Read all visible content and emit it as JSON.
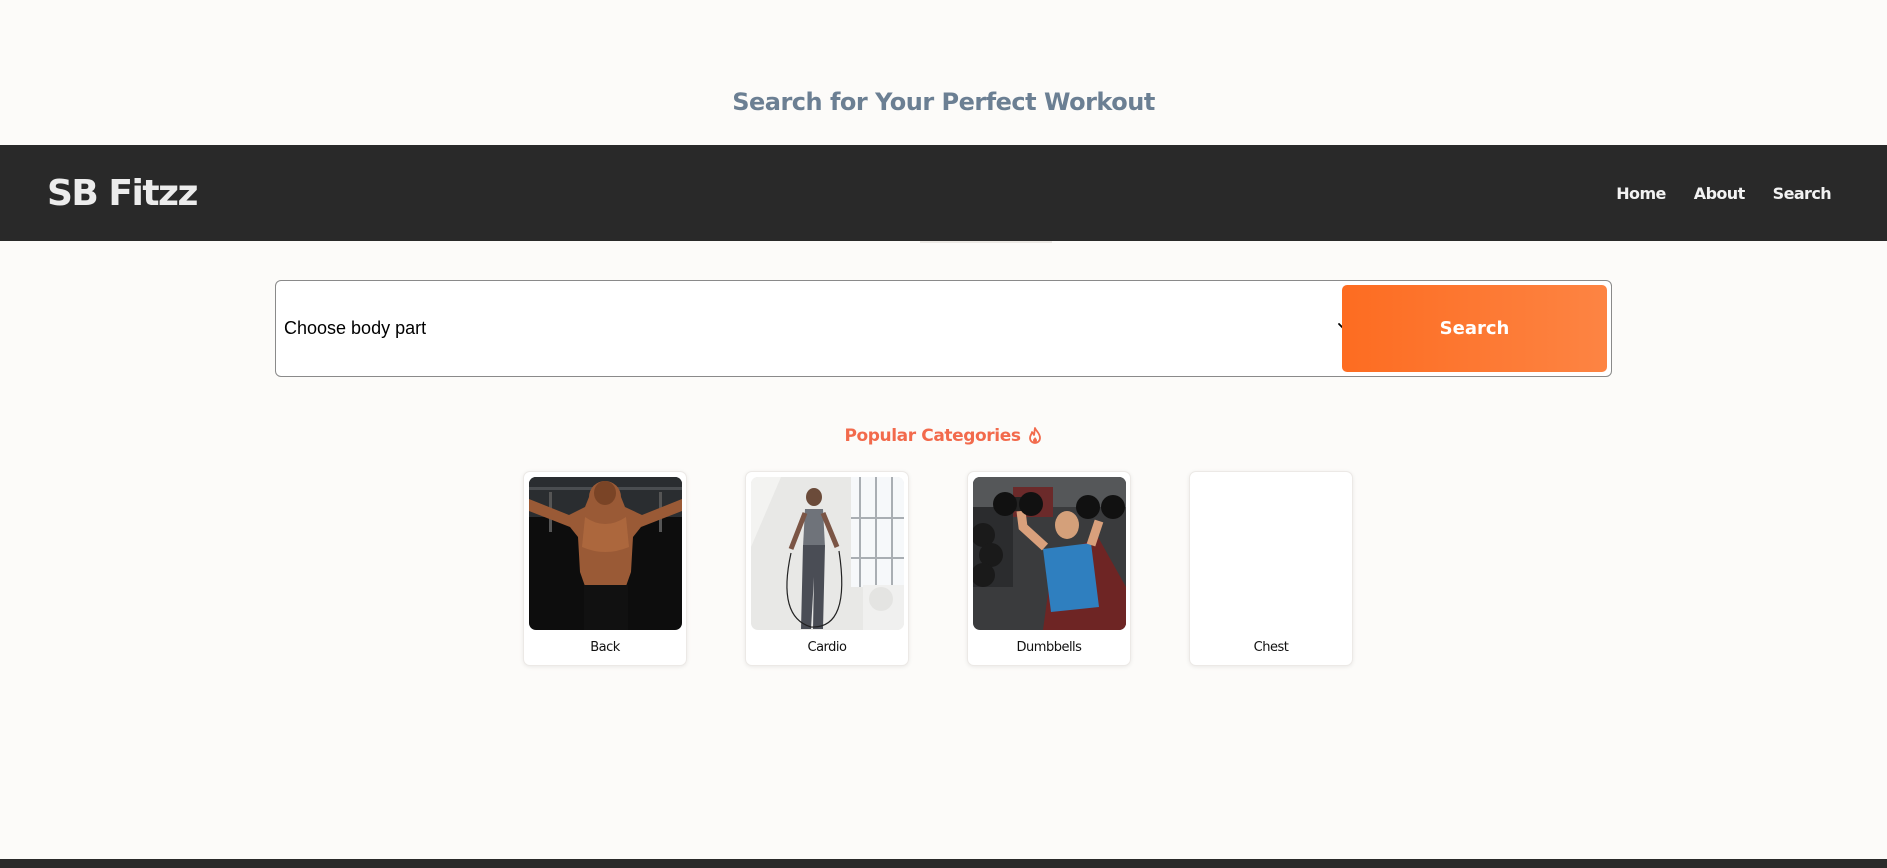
{
  "page": {
    "heading": "Search for Your Perfect Workout"
  },
  "navbar": {
    "brand": "SB Fitzz",
    "links": [
      "Home",
      "About",
      "Search"
    ]
  },
  "search": {
    "select_value": "Choose body part",
    "button_label": "Search"
  },
  "popular": {
    "title": "Popular Categories",
    "icon": "fire-icon",
    "categories": [
      {
        "label": "Back",
        "image": "back-muscles-photo"
      },
      {
        "label": "Cardio",
        "image": "jump-rope-photo"
      },
      {
        "label": "Dumbbells",
        "image": "dumbbell-press-photo"
      },
      {
        "label": "Chest",
        "image": ""
      }
    ]
  },
  "colors": {
    "navbar_bg": "#292929",
    "accent": "#fd6c21",
    "section_title": "#f26a4c",
    "heading": "#6b7f93",
    "page_bg": "#fcfbf9"
  }
}
